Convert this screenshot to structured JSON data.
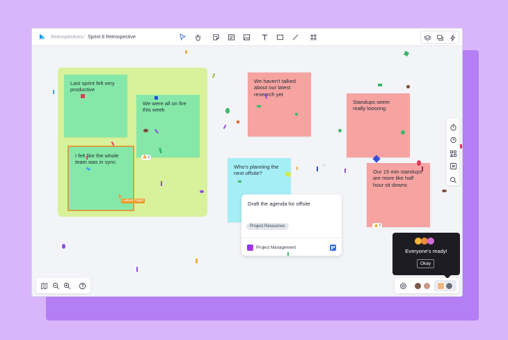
{
  "header": {
    "breadcrumb_root": "Retrospectives",
    "separator": "/",
    "board_title": "Sprint 8 Retrospective",
    "toolbar_icons": [
      "cursor-icon",
      "hand-icon",
      "sticky-note-icon",
      "text-box-icon",
      "image-icon",
      "text-icon",
      "rectangle-icon",
      "line-icon",
      "frame-icon"
    ],
    "right_icons": [
      "layers-icon",
      "comments-icon",
      "lightning-icon"
    ]
  },
  "stickies": {
    "s1": "Last sprint felt very productive",
    "s2": "We were all on fire this week",
    "s3": "I felt like the whole team was in sync",
    "s4": "We haven't talked about our latest research yet",
    "s5": "Standups seem really loooong",
    "s6": "Who's planning the next offsite?",
    "s7": "Our 15 min standups are more like half hour sit downs"
  },
  "reactions": {
    "r1": "🔥 1",
    "r2": "👍 1"
  },
  "cursor_user": "Lukasz Sagol",
  "card": {
    "title": "Draft the agenda for offsite",
    "tag": "Project Resources",
    "project": "Project Management"
  },
  "side_tools": [
    "timer-icon",
    "alarm-icon",
    "templates-icon",
    "grid-icon",
    "search-icon"
  ],
  "bottom_left_tools": [
    "map-icon",
    "zoom-out-icon",
    "zoom-in-icon",
    "help-icon"
  ],
  "popup": {
    "message": "Everyone's ready!",
    "button": "Okay"
  },
  "colors": {
    "background": "#d9b6fb",
    "back_panel": "#b47ef5",
    "frame": "#d7f29a",
    "sticky_green": "#86e8a8",
    "sticky_red": "#f6a3a1",
    "sticky_cyan": "#a6eef6",
    "cursor_tag": "#e99a2a"
  }
}
